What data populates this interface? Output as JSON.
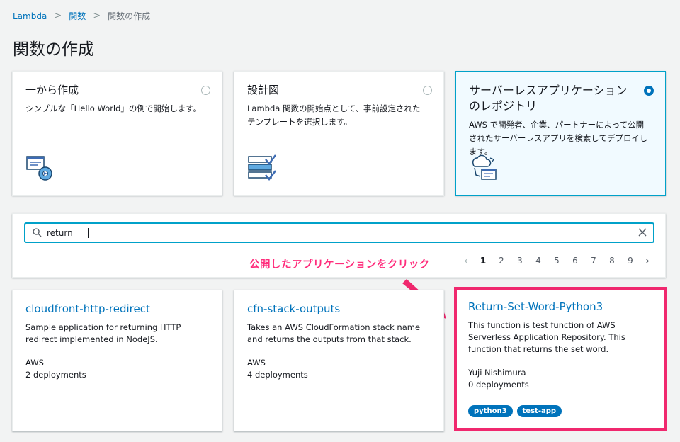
{
  "breadcrumb": {
    "items": [
      "Lambda",
      "関数"
    ],
    "current": "関数の作成"
  },
  "page_title": "関数の作成",
  "options": [
    {
      "title": "一から作成",
      "desc": "シンプルな「Hello World」の例で開始します。",
      "selected": false,
      "icon": "author-from-scratch-icon"
    },
    {
      "title": "設計図",
      "desc": "Lambda 関数の開始点として、事前設定されたテンプレートを選択します。",
      "selected": false,
      "icon": "blueprint-icon"
    },
    {
      "title": "サーバーレスアプリケーションのレポジトリ",
      "desc": "AWS で開発者、企業、パートナーによって公開されたサーバーレスアプリを検索してデプロイします。",
      "selected": true,
      "icon": "serverless-repo-icon"
    }
  ],
  "search": {
    "value": "return"
  },
  "pagination": {
    "pages": [
      "1",
      "2",
      "3",
      "4",
      "5",
      "6",
      "7",
      "8",
      "9"
    ],
    "current": "1"
  },
  "annotation": "公開したアプリケーションをクリック",
  "apps": [
    {
      "name": "cloudfront-http-redirect",
      "desc": "Sample application for returning HTTP redirect implemented in NodeJS.",
      "author": "AWS",
      "deployments": "2 deployments",
      "tags": []
    },
    {
      "name": "cfn-stack-outputs",
      "desc": "Takes an AWS CloudFormation stack name and returns the outputs from that stack.",
      "author": "AWS",
      "deployments": "4 deployments",
      "tags": []
    },
    {
      "name": "Return-Set-Word-Python3",
      "desc": "This function is test function of AWS Serverless Application Repository. This function that returns the set word.",
      "author": "Yuji Nishimura",
      "deployments": "0 deployments",
      "tags": [
        "python3",
        "test-app"
      ]
    }
  ],
  "colors": {
    "link": "#0073bb",
    "accent": "#00a1c9",
    "highlight": "#f0286e",
    "annotation": "#ff2d7c",
    "tag_bg": "#0073bb"
  }
}
